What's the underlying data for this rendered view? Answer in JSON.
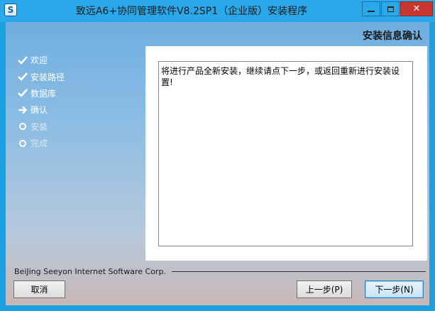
{
  "window": {
    "title": "致远A6+协同管理软件V8.2SP1（企业版）安装程序",
    "icon": "app-logo-icon",
    "controls": [
      "minimize-icon",
      "maximize-icon",
      "close-icon"
    ]
  },
  "page": {
    "heading": "安装信息确认"
  },
  "steps": [
    {
      "label": "欢迎",
      "state": "done",
      "icon": "check-icon"
    },
    {
      "label": "安装路径",
      "state": "done",
      "icon": "check-icon"
    },
    {
      "label": "数据库",
      "state": "done",
      "icon": "check-icon"
    },
    {
      "label": "确认",
      "state": "current",
      "icon": "arrow-right-icon"
    },
    {
      "label": "安装",
      "state": "pending",
      "icon": "circle-icon"
    },
    {
      "label": "完成",
      "state": "pending",
      "icon": "circle-icon"
    }
  ],
  "content": {
    "message": "将进行产品全新安装，继续请点下一步，或返回重新进行安装设置!"
  },
  "footer": {
    "company": "BeiJing Seeyon Internet Software Corp.",
    "cancel_label": "取消",
    "prev_label": "上一步(P)",
    "next_label": "下一步(N)"
  },
  "colors": {
    "frame": "#1ba1e2",
    "close_button": "#c7372f",
    "step_text": "#ffffff"
  }
}
